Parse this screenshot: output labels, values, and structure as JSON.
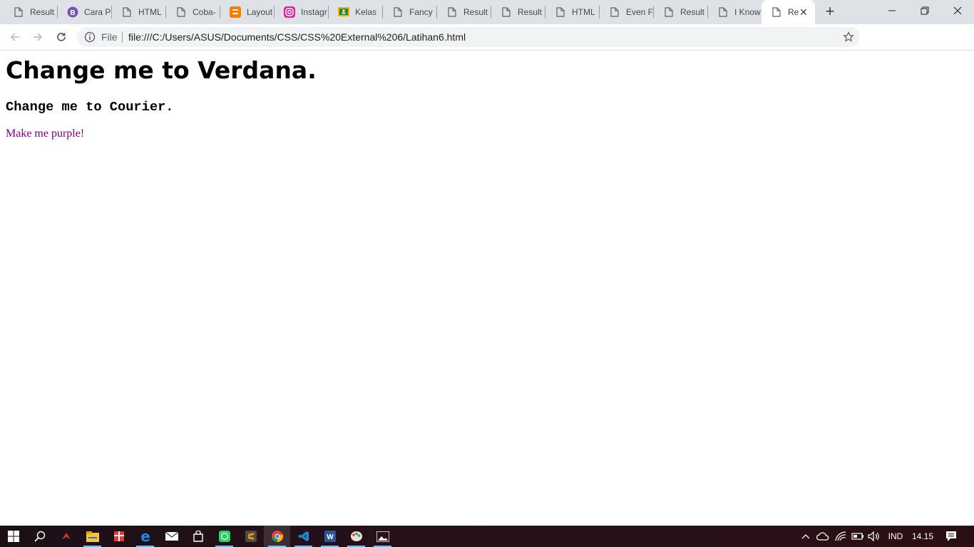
{
  "browser": {
    "tabs": [
      {
        "label": "Result",
        "icon": "page-icon"
      },
      {
        "label": "Cara P",
        "icon": "bootstrap-icon"
      },
      {
        "label": "HTML",
        "icon": "page-icon"
      },
      {
        "label": "Coba-",
        "icon": "page-icon"
      },
      {
        "label": "Layout",
        "icon": "blogger-icon"
      },
      {
        "label": "Instagr",
        "icon": "instagram-icon"
      },
      {
        "label": "Kelas",
        "icon": "classroom-icon"
      },
      {
        "label": "Fancy",
        "icon": "page-icon"
      },
      {
        "label": "Result",
        "icon": "page-icon"
      },
      {
        "label": "Result",
        "icon": "page-icon"
      },
      {
        "label": "HTML",
        "icon": "page-icon"
      },
      {
        "label": "Even F",
        "icon": "page-icon"
      },
      {
        "label": "Result",
        "icon": "page-icon"
      },
      {
        "label": "I Know",
        "icon": "page-icon"
      },
      {
        "label": "Re",
        "icon": "page-icon",
        "active": true
      }
    ],
    "address": {
      "scheme_label": "File",
      "url": "file:///C:/Users/ASUS/Documents/CSS/CSS%20External%206/Latihan6.html"
    }
  },
  "page": {
    "heading1": "Change me to Verdana.",
    "heading3": "Change me to Courier.",
    "paragraph": "Make me purple!",
    "paragraph_color": "#800080"
  },
  "taskbar": {
    "apps": [
      "start-icon",
      "search-icon",
      "game-app-icon",
      "file-explorer-icon",
      "gift-app-icon",
      "edge-icon",
      "mail-icon",
      "store-icon",
      "whatsapp-icon",
      "sublime-icon",
      "chrome-icon",
      "vscode-icon",
      "word-icon",
      "paint-icon",
      "photos-icon"
    ],
    "language": "IND",
    "time": "14.15"
  }
}
